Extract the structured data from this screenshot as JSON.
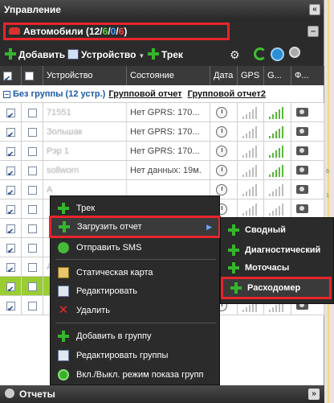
{
  "panel": {
    "title": "Управление",
    "collapse_icon": "double-left-icon"
  },
  "cars": {
    "label": "Автомобили (12/",
    "count_green": "6",
    "sep1": "/",
    "count_blue": "0",
    "sep2": "/",
    "count_red": "6",
    "close": ")"
  },
  "toolbar": {
    "add_label": "Добавить",
    "device_label": "Устройство",
    "track_label": "Трек"
  },
  "table": {
    "headers": {
      "device": "Устройство",
      "state": "Состояние",
      "date": "Дата",
      "gps": "GPS",
      "gsm": "G...",
      "photo": "Ф..."
    },
    "group": {
      "label": "Без группы (12 устр.)",
      "report1": "Групповой отчет",
      "report2": "Групповой отчет2"
    },
    "rows": [
      {
        "device": "71551",
        "state": "Нет GPRS: 170..."
      },
      {
        "device": "Зольшак",
        "state": "Нет GPRS: 170..."
      },
      {
        "device": "Рэр 1",
        "state": "Нет GPRS: 170..."
      },
      {
        "device": "sollworn",
        "state": "Нет данных: 19м."
      },
      {
        "device": "А",
        "state": ""
      },
      {
        "device": "",
        "state": ""
      },
      {
        "device": "",
        "state": ""
      },
      {
        "device": "",
        "state": ""
      },
      {
        "device": "А",
        "state": ""
      },
      {
        "device": "",
        "state": ""
      },
      {
        "device": "",
        "state": ""
      }
    ]
  },
  "context_menu": {
    "track": "Трек",
    "load_report": "Загрузить отчет",
    "send_sms": "Отправить SMS",
    "static_map": "Статическая карта",
    "edit": "Редактировать",
    "delete": "Удалить",
    "add_to_group": "Добавить в группу",
    "edit_groups": "Редактировать группы",
    "toggle_groups": "Вкл./Выкл. режим показа групп"
  },
  "submenu": {
    "summary": "Сводный",
    "diagnostic": "Диагностический",
    "motohours": "Моточасы",
    "fuel": "Расходомер"
  },
  "bottom": {
    "reports": "Отчеты"
  },
  "map_strip": {
    "n1": "6",
    "n2": "1"
  }
}
